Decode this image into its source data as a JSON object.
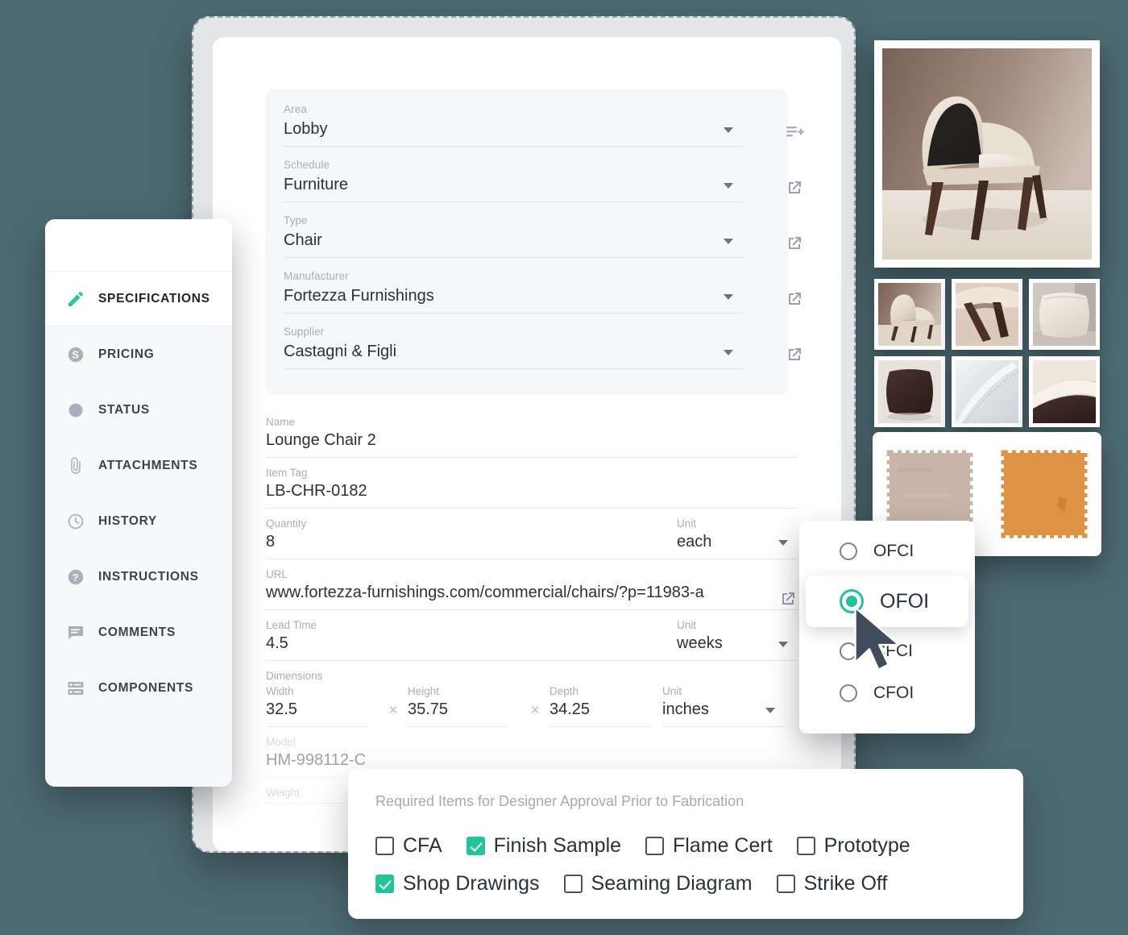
{
  "theme": {
    "background": "#4d6a72",
    "accent_green": "#22c49a",
    "text_dark": "#2b3139",
    "label_grey": "#a9aeb6"
  },
  "sidebar": {
    "items": [
      {
        "label": "SPECIFICATIONS",
        "icon": "pencil-icon",
        "active": true
      },
      {
        "label": "PRICING",
        "icon": "dollar-circle-icon",
        "active": false
      },
      {
        "label": "STATUS",
        "icon": "circle-icon",
        "active": false
      },
      {
        "label": "ATTACHMENTS",
        "icon": "paperclip-icon",
        "active": false
      },
      {
        "label": "HISTORY",
        "icon": "clock-icon",
        "active": false
      },
      {
        "label": "INSTRUCTIONS",
        "icon": "question-circle-icon",
        "active": false
      },
      {
        "label": "COMMENTS",
        "icon": "comment-icon",
        "active": false
      },
      {
        "label": "COMPONENTS",
        "icon": "components-icon",
        "active": false
      }
    ]
  },
  "form": {
    "select_fields": [
      {
        "label": "Area",
        "value": "Lobby",
        "icon": "playlist-add-icon"
      },
      {
        "label": "Schedule",
        "value": "Furniture",
        "icon": "external-link-icon"
      },
      {
        "label": "Type",
        "value": "Chair",
        "icon": "external-link-icon"
      },
      {
        "label": "Manufacturer",
        "value": "Fortezza Furnishings",
        "icon": "external-link-icon"
      },
      {
        "label": "Supplier",
        "value": "Castagni & Figli",
        "icon": "external-link-icon"
      }
    ],
    "name": {
      "label": "Name",
      "value": "Lounge Chair 2"
    },
    "item_tag": {
      "label": "Item Tag",
      "value": "LB-CHR-0182"
    },
    "quantity": {
      "label": "Quantity",
      "value": "8"
    },
    "quantity_unit": {
      "label": "Unit",
      "value": "each"
    },
    "url": {
      "label": "URL",
      "value": "www.fortezza-furnishings.com/commercial/chairs/?p=11983-a",
      "icon": "external-link-icon"
    },
    "lead_time": {
      "label": "Lead Time",
      "value": "4.5"
    },
    "lead_time_unit": {
      "label": "Unit",
      "value": "weeks"
    },
    "dimensions": {
      "heading": "Dimensions",
      "width": {
        "label": "Width",
        "value": "32.5"
      },
      "height": {
        "label": "Height",
        "value": "35.75"
      },
      "depth": {
        "label": "Depth",
        "value": "34.25"
      },
      "unit": {
        "label": "Unit",
        "value": "inches"
      },
      "separator": "×"
    },
    "model": {
      "label": "Model",
      "value": "HM-998112-C"
    },
    "weight": {
      "label": "Weight",
      "value": ""
    }
  },
  "procurement_popup": {
    "options": [
      {
        "label": "OFCI",
        "selected": false,
        "highlighted": false
      },
      {
        "label": "OFOI",
        "selected": true,
        "highlighted": true
      },
      {
        "label": "CFCI",
        "selected": false,
        "highlighted": false
      },
      {
        "label": "CFOI",
        "selected": false,
        "highlighted": false
      }
    ]
  },
  "approval_panel": {
    "title": "Required Items for Designer Approval Prior to Fabrication",
    "rows": [
      [
        {
          "label": "CFA",
          "checked": false
        },
        {
          "label": "Finish Sample",
          "checked": true
        },
        {
          "label": "Flame Cert",
          "checked": false
        },
        {
          "label": "Prototype",
          "checked": false
        }
      ],
      [
        {
          "label": "Shop Drawings",
          "checked": true
        },
        {
          "label": "Seaming Diagram",
          "checked": false
        },
        {
          "label": "Strike Off",
          "checked": false
        }
      ]
    ]
  },
  "media": {
    "hero": {
      "name": "lounge-chair-hero-photo"
    },
    "thumbnails": [
      {
        "name": "chair-full-view-thumb"
      },
      {
        "name": "chair-legs-detail-thumb"
      },
      {
        "name": "white-cushion-thumb"
      },
      {
        "name": "dark-brown-cushion-thumb"
      },
      {
        "name": "white-fabric-seam-thumb"
      },
      {
        "name": "chair-arm-detail-thumb"
      }
    ],
    "swatches": [
      {
        "name": "beige-fabric-swatch",
        "color": "#c8b4a8"
      },
      {
        "name": "orange-fabric-swatch",
        "color": "#dd9244"
      }
    ]
  }
}
